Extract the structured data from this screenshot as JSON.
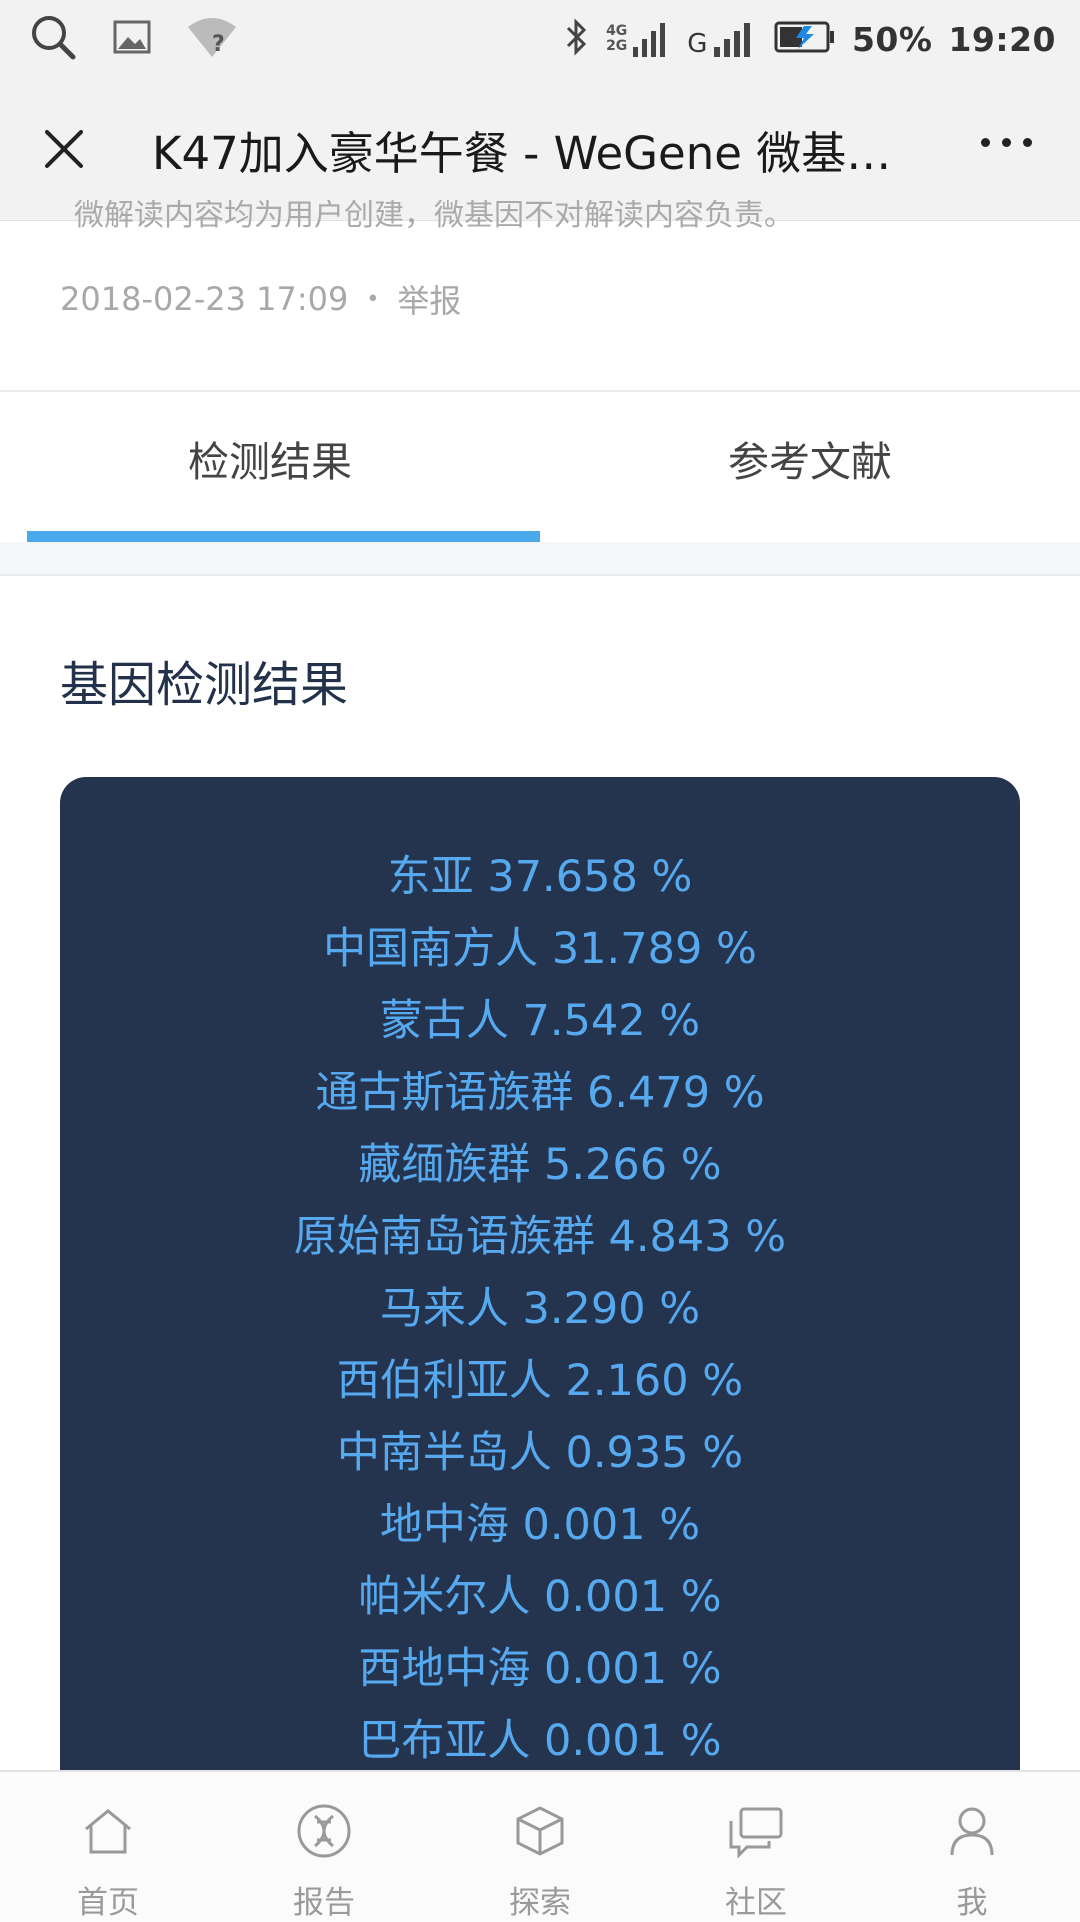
{
  "status_bar": {
    "net_4g": "4G",
    "net_2g": "2G",
    "signal_label": "G",
    "battery": "50%",
    "time": "19:20"
  },
  "header": {
    "title": "K47加入豪华午餐 - WeGene 微基…"
  },
  "article": {
    "disclaimer_partial": "微解读内容均为用户创建，微基因不对解读内容负责。",
    "date": "2018-02-23 17:09",
    "separator": "•",
    "report_label": "举报"
  },
  "tabs": [
    {
      "label": "检测结果",
      "active": true
    },
    {
      "label": "参考文献",
      "active": false
    }
  ],
  "section_title": "基因检测结果",
  "results": [
    "东亚 37.658 %",
    "中国南方人 31.789 %",
    "蒙古人 7.542 %",
    "通古斯语族群 6.479 %",
    "藏缅族群 5.266 %",
    "原始南岛语族群 4.843 %",
    "马来人 3.290 %",
    "西伯利亚人 2.160 %",
    "中南半岛人 0.935 %",
    "地中海 0.001 %",
    "帕米尔人 0.001 %",
    "西地中海 0.001 %",
    "巴布亚人 0.001 %"
  ],
  "bottom_nav": [
    {
      "label": "首页",
      "icon": "home-icon"
    },
    {
      "label": "报告",
      "icon": "dna-report-icon"
    },
    {
      "label": "探索",
      "icon": "cube-icon"
    },
    {
      "label": "社区",
      "icon": "chat-icon"
    },
    {
      "label": "我",
      "icon": "person-icon"
    }
  ],
  "colors": {
    "accent": "#4aa8ec",
    "card_bg": "#24344f",
    "result_text": "#57a9ef"
  }
}
